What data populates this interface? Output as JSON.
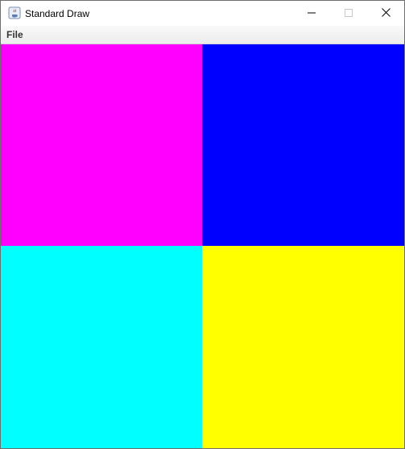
{
  "window": {
    "title": "Standard Draw",
    "app_icon": "java-cup-icon",
    "controls": [
      "minimize-icon",
      "maximize-icon",
      "close-icon"
    ]
  },
  "menubar": {
    "items": [
      {
        "label": "File"
      }
    ]
  },
  "canvas": {
    "quadrants": [
      {
        "position": "top-left",
        "color": "#ff00ff"
      },
      {
        "position": "top-right",
        "color": "#0000ff"
      },
      {
        "position": "bottom-left",
        "color": "#00ffff"
      },
      {
        "position": "bottom-right",
        "color": "#ffff00"
      }
    ]
  }
}
